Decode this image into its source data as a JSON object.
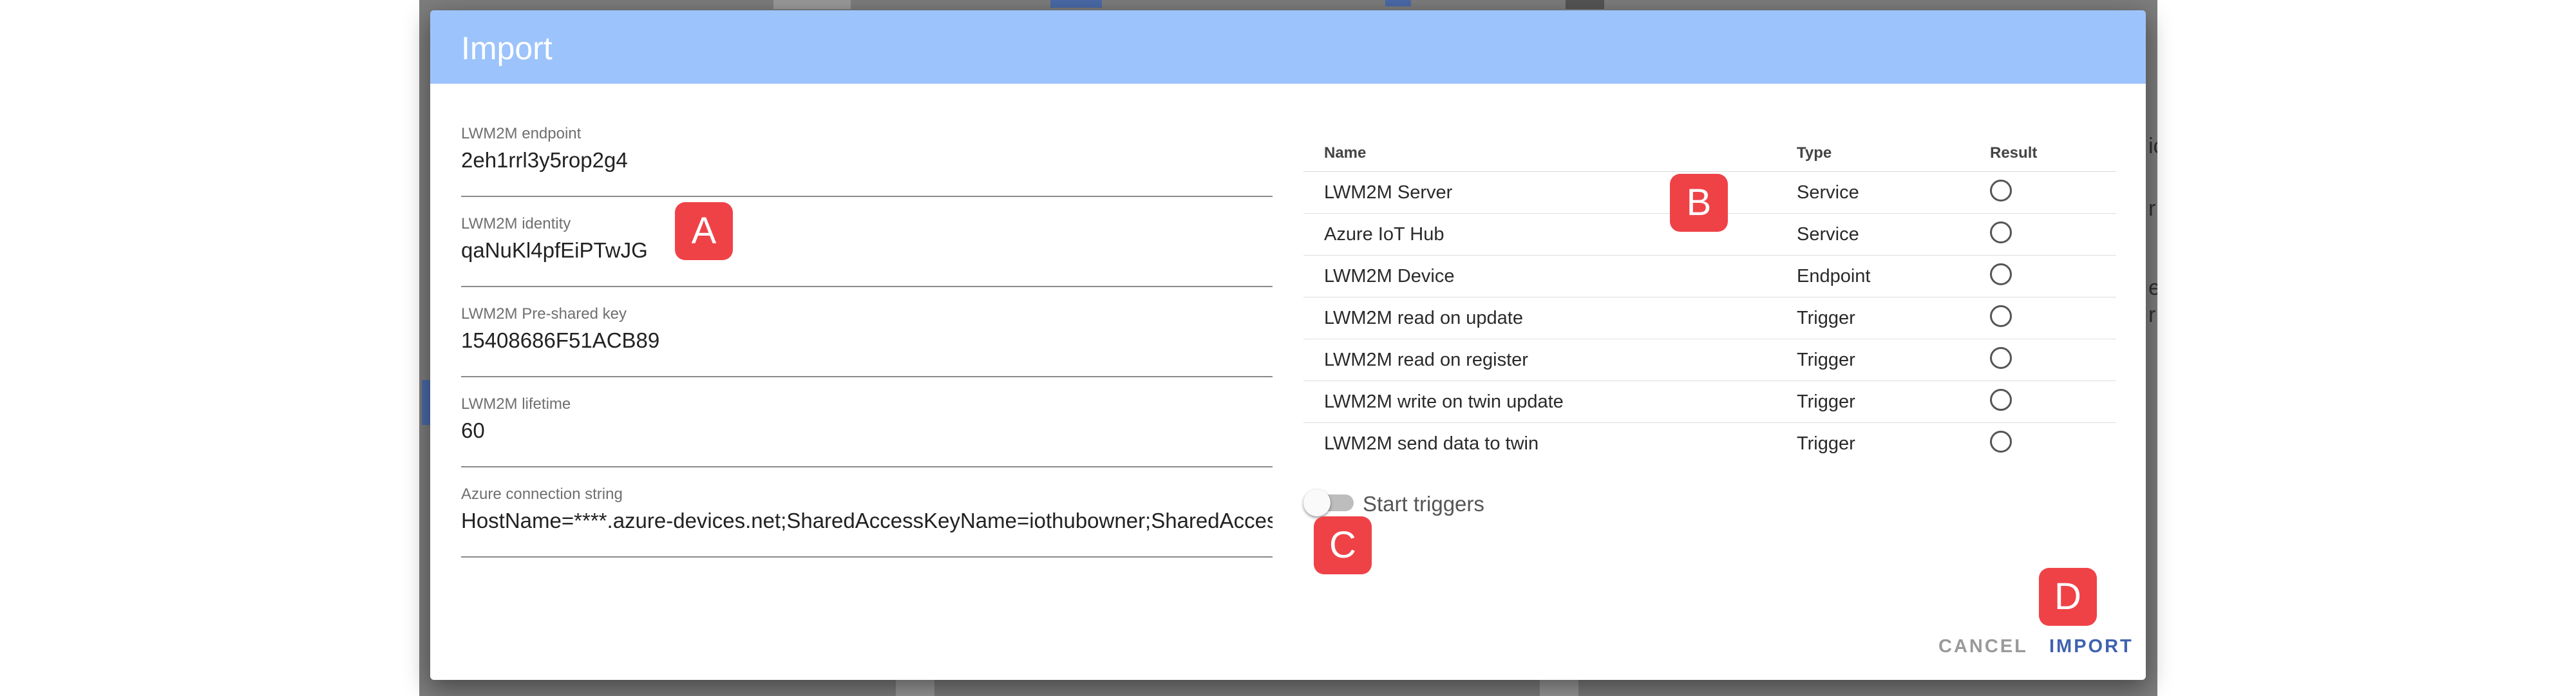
{
  "dialog": {
    "title": "Import"
  },
  "fields": [
    {
      "label": "LWM2M endpoint",
      "value": "2eh1rrl3y5rop2g4"
    },
    {
      "label": "LWM2M identity",
      "value": "qaNuKl4pfEiPTwJG"
    },
    {
      "label": "LWM2M Pre-shared key",
      "value": "15408686F51ACB89"
    },
    {
      "label": "LWM2M lifetime",
      "value": "60"
    },
    {
      "label": "Azure connection string",
      "value": "HostName=****.azure-devices.net;SharedAccessKeyName=iothubowner;SharedAccessKey"
    }
  ],
  "table": {
    "headers": {
      "name": "Name",
      "type": "Type",
      "result": "Result"
    },
    "rows": [
      {
        "name": "LWM2M Server",
        "type": "Service"
      },
      {
        "name": "Azure IoT Hub",
        "type": "Service"
      },
      {
        "name": "LWM2M Device",
        "type": "Endpoint"
      },
      {
        "name": "LWM2M read on update",
        "type": "Trigger"
      },
      {
        "name": "LWM2M read on register",
        "type": "Trigger"
      },
      {
        "name": "LWM2M write on twin update",
        "type": "Trigger"
      },
      {
        "name": "LWM2M send data to twin",
        "type": "Trigger"
      }
    ]
  },
  "toggle": {
    "label": "Start triggers",
    "checked": false
  },
  "actions": {
    "cancel": "CANCEL",
    "import": "IMPORT"
  },
  "markers": {
    "a": "A",
    "b": "B",
    "c": "C",
    "d": "D"
  },
  "background": {
    "snippet_1": "ic",
    "snippet_2": "r",
    "snippet_3": "e",
    "snippet_4": "r"
  },
  "colors": {
    "header": "#9cc3fb",
    "primary_action": "#3f62b0",
    "marker": "#ef4247",
    "backdrop": "#7d7d7d"
  }
}
